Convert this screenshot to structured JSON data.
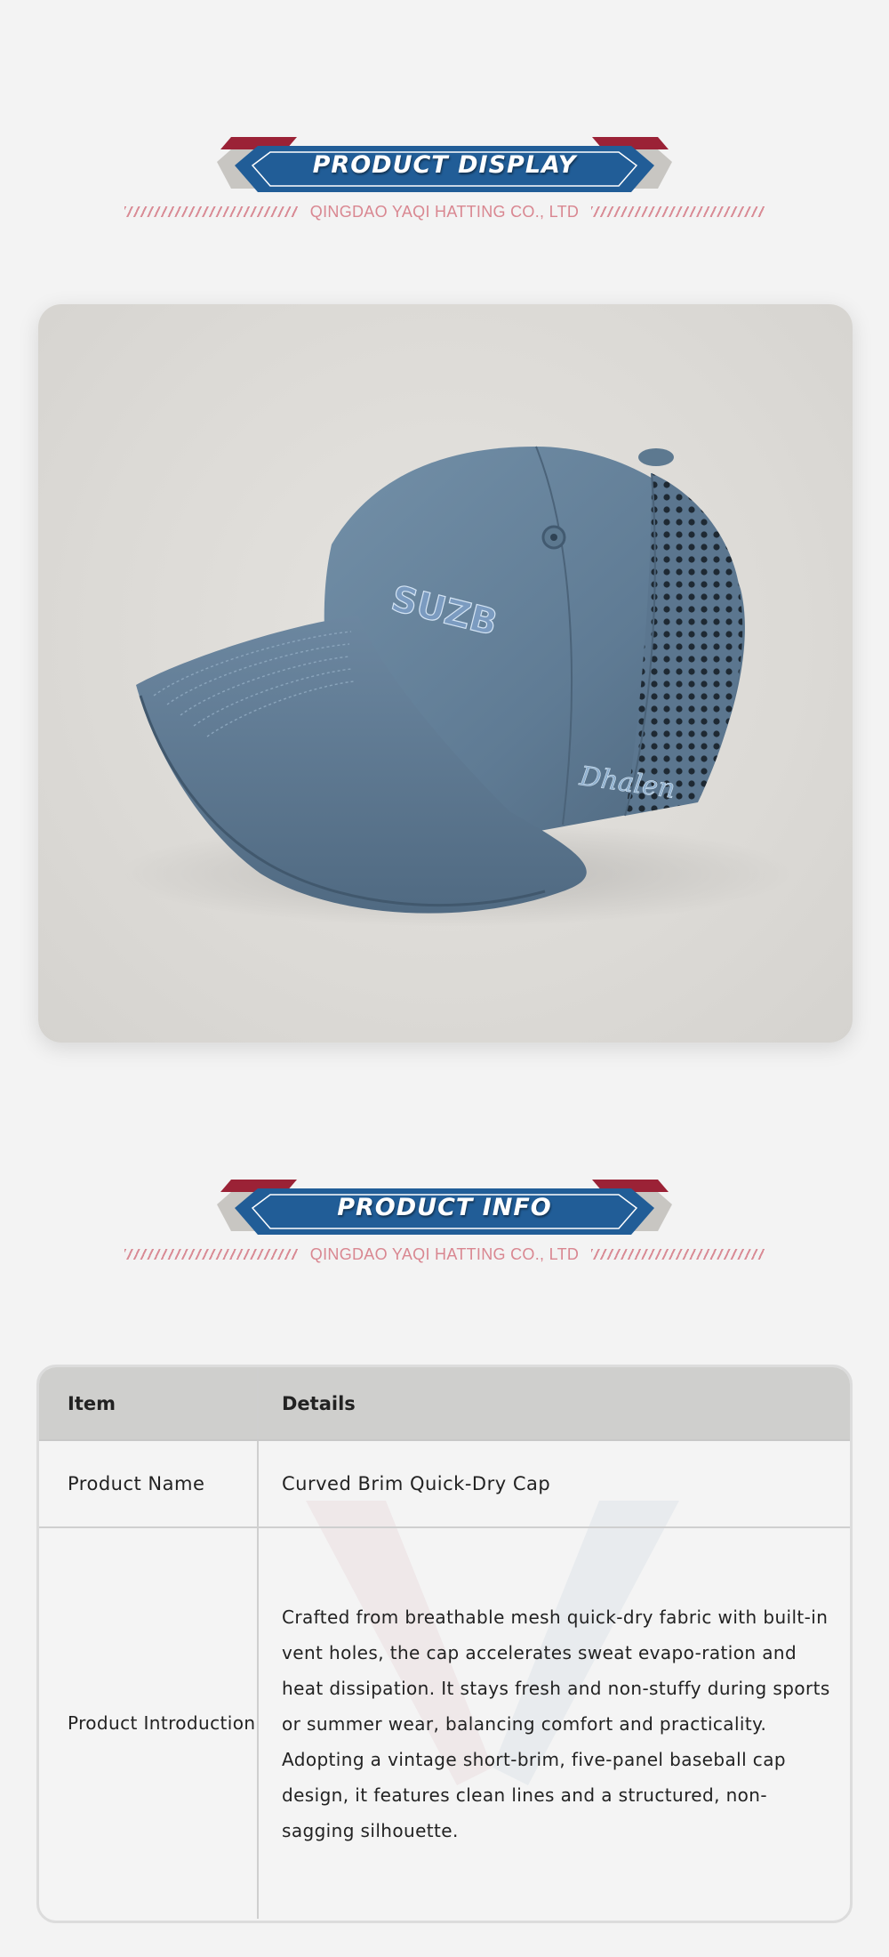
{
  "display_section": {
    "banner_title": "PRODUCT DISPLAY",
    "company": "QINGDAO YAQI HATTING CO., LTD"
  },
  "product_image": {
    "description_icon": "baseball-cap-photo",
    "front_embroidery": "SUZB",
    "side_embroidery": "Dhalen"
  },
  "info_section": {
    "banner_title": "PRODUCT INFO",
    "company": "QINGDAO YAQI HATTING CO., LTD"
  },
  "table": {
    "headers": {
      "item": "Item",
      "details": "Details"
    },
    "rows": [
      {
        "item": "Product Name",
        "details": "Curved Brim Quick-Dry Cap"
      },
      {
        "item": "Product Introduction",
        "details_p1": "Crafted from breathable mesh quick-dry fabric with built-in vent holes, the cap accelerates sweat evapo-ration and heat dissipation. It stays fresh and non-stuffy during sports or summer wear, balancing comfort and practicality.",
        "details_p2": "Adopting a vintage short-brim, five-panel baseball cap design, it features clean lines and a structured, non-sagging silhouette."
      }
    ]
  },
  "colors": {
    "banner_blue": "#215d97",
    "banner_red": "#9b2236",
    "accent_pink": "#d98791",
    "cap_blue": "#5e7a92",
    "background": "#f3f3f3"
  }
}
